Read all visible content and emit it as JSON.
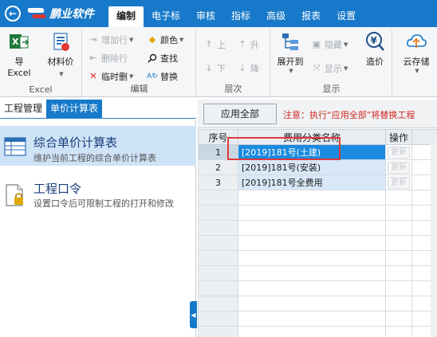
{
  "app": {
    "name": "鹏业软件"
  },
  "menu": [
    {
      "label": "编制",
      "active": true
    },
    {
      "label": "电子标",
      "active": false
    },
    {
      "label": "审核",
      "active": false
    },
    {
      "label": "指标",
      "active": false
    },
    {
      "label": "高级",
      "active": false
    },
    {
      "label": "报表",
      "active": false
    },
    {
      "label": "设置",
      "active": false
    }
  ],
  "ribbon": {
    "excel_group": {
      "label": "Excel",
      "export": "导Excel",
      "material": "材料价"
    },
    "edit_group": {
      "label": "编辑",
      "add_row": "增加行",
      "delete_row": "删除行",
      "temp_delete": "临时删",
      "color": "颜色",
      "find": "查找",
      "replace": "替换"
    },
    "level_group": {
      "label": "层次",
      "up": "上",
      "down": "下",
      "raise": "升",
      "lower": "降"
    },
    "display_group": {
      "label": "显示",
      "expand_to": "展开到",
      "hide": "隐藏",
      "show": "显示",
      "cost": "造价"
    },
    "cloud_group": {
      "cloud_save": "云存储"
    }
  },
  "left": {
    "tabs": [
      {
        "label": "工程管理",
        "active": false
      },
      {
        "label": "单价计算表",
        "active": true
      }
    ],
    "items": [
      {
        "title": "综合单价计算表",
        "desc": "维护当前工程的综合单价计算表"
      },
      {
        "title": "工程口令",
        "desc": "设置口令后可限制工程的打开和修改"
      }
    ]
  },
  "right": {
    "apply_all": "应用全部",
    "notice": "注意：执行“应用全部”将替换工程",
    "columns": {
      "seq": "序号",
      "name": "费用分类名称",
      "op": "操作"
    },
    "rows": [
      {
        "seq": "1",
        "name": "[2019]181号(土建)",
        "op": "更新",
        "selected": true
      },
      {
        "seq": "2",
        "name": "[2019]181号(安装)",
        "op": "更新",
        "selected": false
      },
      {
        "seq": "3",
        "name": "[2019]181号全费用",
        "op": "更新",
        "selected": false
      }
    ]
  },
  "colors": {
    "accent": "#1779c9",
    "selection": "#1b8be0",
    "warning": "#d0261e",
    "highlight": "#e03a3a"
  }
}
